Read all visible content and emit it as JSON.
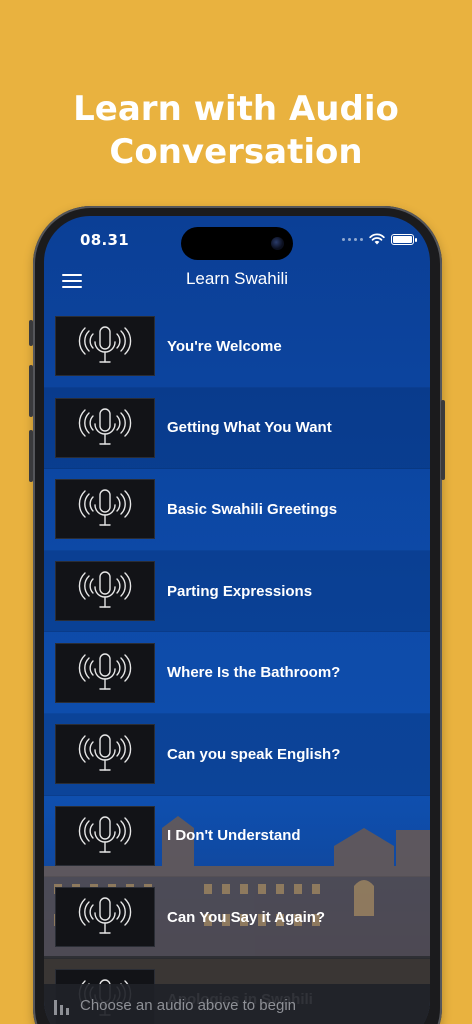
{
  "promo": {
    "line1": "Learn with Audio",
    "line2": "Conversation"
  },
  "status_bar": {
    "time": "08.31"
  },
  "app": {
    "title": "Learn Swahili"
  },
  "lessons": [
    {
      "label": "You're Welcome"
    },
    {
      "label": "Getting What You Want"
    },
    {
      "label": "Basic Swahili Greetings"
    },
    {
      "label": "Parting Expressions"
    },
    {
      "label": "Where Is the Bathroom?"
    },
    {
      "label": "Can you speak English?"
    },
    {
      "label": "I Don't Understand"
    },
    {
      "label": "Can You Say it Again?"
    },
    {
      "label": "Apologies in Swahili"
    }
  ],
  "player": {
    "prompt": "Choose an audio above to begin"
  },
  "colors": {
    "background": "#e9b23f",
    "app_blue": "#0d4aa8",
    "text": "#ffffff"
  }
}
